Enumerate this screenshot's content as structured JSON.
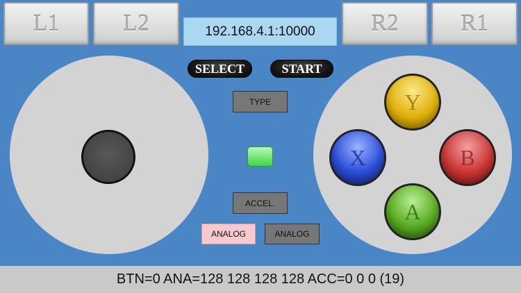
{
  "shoulder_buttons": {
    "l1": "L1",
    "l2": "L2",
    "r2": "R2",
    "r1": "R1"
  },
  "connection": {
    "address": "192.168.4.1:10000"
  },
  "system_buttons": {
    "select": "SELECT",
    "start": "START"
  },
  "center_controls": {
    "type_label": "TYPE",
    "accel_label": "ACCEL.",
    "analog_left_label": "ANALOG",
    "analog_right_label": "ANALOG"
  },
  "face_buttons": {
    "y": "Y",
    "x": "X",
    "b": "B",
    "a": "A"
  },
  "colors": {
    "background": "#4a86c5",
    "button_y": "#e0b20b",
    "button_x": "#2d4fd6",
    "button_b": "#cc3535",
    "button_a": "#5aab22",
    "indicator": "#3fd843",
    "analog_active": "#f7c9cf"
  },
  "icons": {
    "indicator": "status-led-icon"
  },
  "status": {
    "text": "BTN=0 ANA=128 128 128 128 ACC=0 0 0 (19)"
  }
}
